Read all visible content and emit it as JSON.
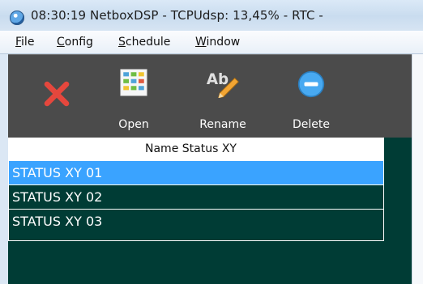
{
  "window": {
    "title": "08:30:19  NetboxDSP - TCPUdsp: 13,45% -  RTC  -"
  },
  "menubar": {
    "items": [
      {
        "first": "F",
        "rest": "ile"
      },
      {
        "first": "C",
        "rest": "onfig"
      },
      {
        "first": "S",
        "rest": "chedule"
      },
      {
        "first": "W",
        "rest": "indow"
      }
    ]
  },
  "toolbar": {
    "buttons": [
      {
        "label": "",
        "icon": "close-x-icon",
        "color": "#e5473d"
      },
      {
        "label": "Open",
        "icon": "grid-icon"
      },
      {
        "label": "Rename",
        "icon": "rename-pencil-icon"
      },
      {
        "label": "Delete",
        "icon": "delete-minus-icon"
      }
    ]
  },
  "list": {
    "header": "Name  Status XY",
    "rows": [
      {
        "label": "STATUS XY 01",
        "selected": true
      },
      {
        "label": "STATUS XY 02",
        "selected": false
      },
      {
        "label": "STATUS XY 03",
        "selected": false
      }
    ]
  },
  "colors": {
    "selected_row": "#3aa3ff",
    "list_background": "#003c35",
    "toolbar_background": "#4b4b4b"
  }
}
